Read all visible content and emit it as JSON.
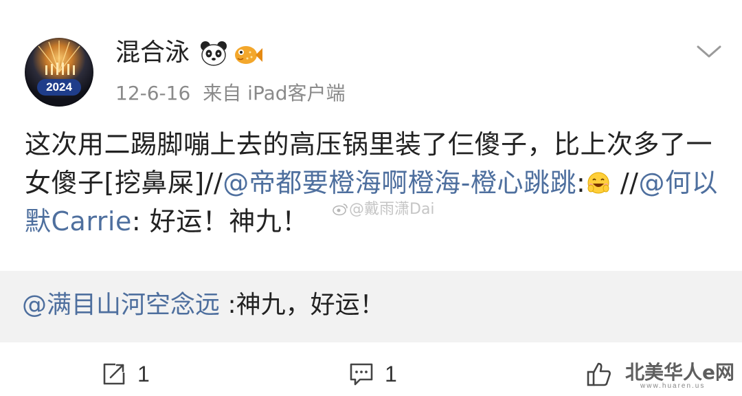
{
  "post": {
    "username": "混合泳",
    "avatar_badge_year": "2024",
    "badges": [
      "panda-icon",
      "fish-icon"
    ],
    "timestamp": "12-6-16",
    "source": "来自 iPad客户端",
    "text_part1": "这次用二踢脚嘣上去的高压锅里装了仨傻子，比上次多了一女傻子[挖鼻屎]//",
    "mention1": "@帝都要橙海啊橙海-橙心跳跳",
    "text_part2": ":",
    "text_part3": " //",
    "mention2": "@何以默Carrie",
    "text_part4": ": 好运！神九！"
  },
  "repost": {
    "mention": "@满目山河空念远",
    "text": " :神九，好运！"
  },
  "actions": {
    "repost_count": "1",
    "comment_count": "1"
  },
  "watermarks": {
    "weibo": "@戴雨潇Dai",
    "site": "北美华人e网",
    "site_url": "www.huaren.us"
  },
  "colors": {
    "mention": "#4e6f9e",
    "text": "#222222",
    "meta": "#8a8a8a",
    "repost_bg": "#f2f2f2"
  }
}
